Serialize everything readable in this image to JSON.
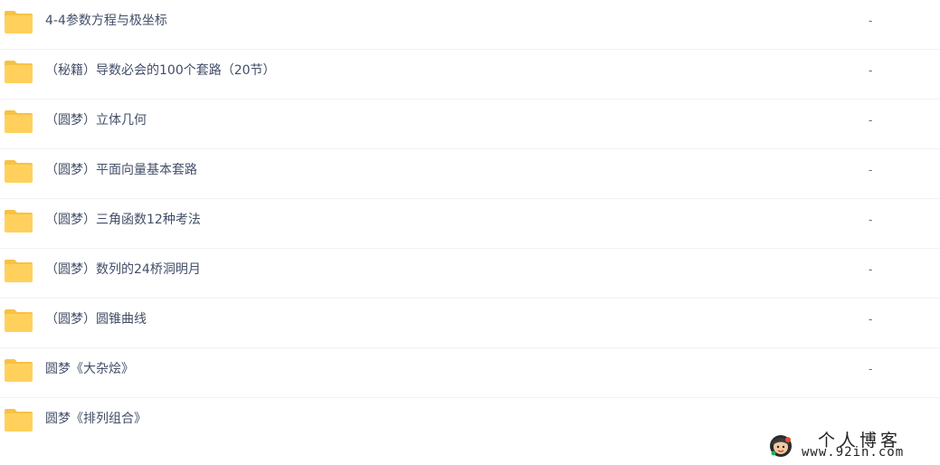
{
  "file_list": {
    "items": [
      {
        "icon": "folder-icon",
        "name": "4-4参数方程与极坐标",
        "size": "-"
      },
      {
        "icon": "folder-icon",
        "name": "（秘籍）导数必会的100个套路（20节）",
        "size": "-"
      },
      {
        "icon": "folder-icon",
        "name": "（圆梦）立体几何",
        "size": "-"
      },
      {
        "icon": "folder-icon",
        "name": "（圆梦）平面向量基本套路",
        "size": "-"
      },
      {
        "icon": "folder-icon",
        "name": "（圆梦）三角函数12种考法",
        "size": "-"
      },
      {
        "icon": "folder-icon",
        "name": "（圆梦）数列的24桥洞明月",
        "size": "-"
      },
      {
        "icon": "folder-icon",
        "name": "（圆梦）圆锥曲线",
        "size": "-"
      },
      {
        "icon": "folder-icon",
        "name": "圆梦《大杂烩》",
        "size": "-"
      },
      {
        "icon": "folder-icon",
        "name": "圆梦《排列组合》",
        "size": ""
      }
    ]
  },
  "watermark": {
    "title": "个人博客",
    "url": "www.92in.com",
    "avatar_icon": "avatar-mascot-icon"
  },
  "colors": {
    "folder_fill": "#FFD15C",
    "folder_tab": "#F7C244",
    "text": "#424E67",
    "divider": "#F1F2F4"
  }
}
